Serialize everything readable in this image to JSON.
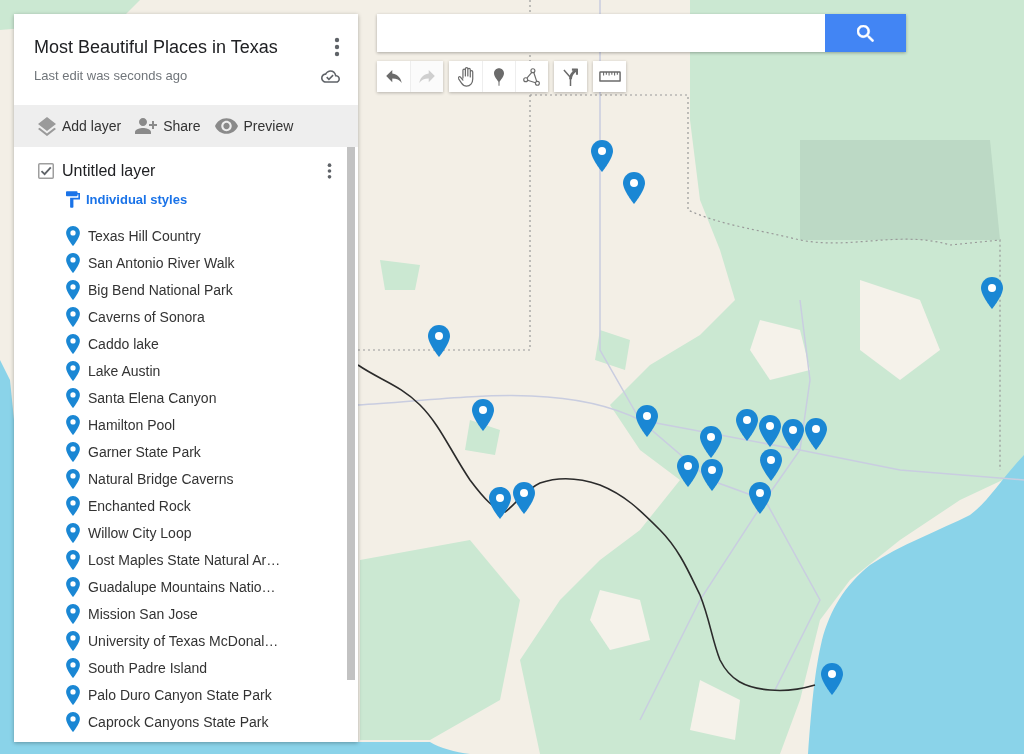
{
  "panel": {
    "title": "Most Beautiful Places in Texas",
    "subtitle": "Last edit was seconds ago",
    "actions": [
      {
        "kind": "add_layer",
        "label": "Add layer"
      },
      {
        "kind": "share",
        "label": "Share"
      },
      {
        "kind": "preview",
        "label": "Preview"
      }
    ],
    "layer": {
      "name": "Untitled layer",
      "checked": true,
      "style": "Individual styles",
      "places": [
        "Texas Hill Country",
        "San Antonio River Walk",
        "Big Bend National Park",
        "Caverns of Sonora",
        "Caddo lake",
        "Lake Austin",
        "Santa Elena Canyon",
        "Hamilton Pool",
        "Garner State Park",
        "Natural Bridge Caverns",
        "Enchanted Rock",
        "Willow City Loop",
        "Lost Maples State Natural Ar…",
        "Guadalupe Mountains Natio…",
        "Mission San Jose",
        "University of Texas McDonal…",
        "South Padre Island",
        "Palo Duro Canyon State Park",
        "Caprock Canyons State Park"
      ]
    }
  },
  "tool_groups": [
    {
      "tools": [
        {
          "kind": "undo",
          "disabled": false
        },
        {
          "kind": "redo",
          "disabled": true
        }
      ]
    },
    {
      "tools": [
        {
          "kind": "hand",
          "disabled": false
        },
        {
          "kind": "marker",
          "disabled": false
        },
        {
          "kind": "line",
          "disabled": false
        }
      ]
    },
    {
      "tools": [
        {
          "kind": "route",
          "disabled": false
        }
      ]
    },
    {
      "tools": [
        {
          "kind": "ruler",
          "disabled": false
        }
      ]
    }
  ]
}
